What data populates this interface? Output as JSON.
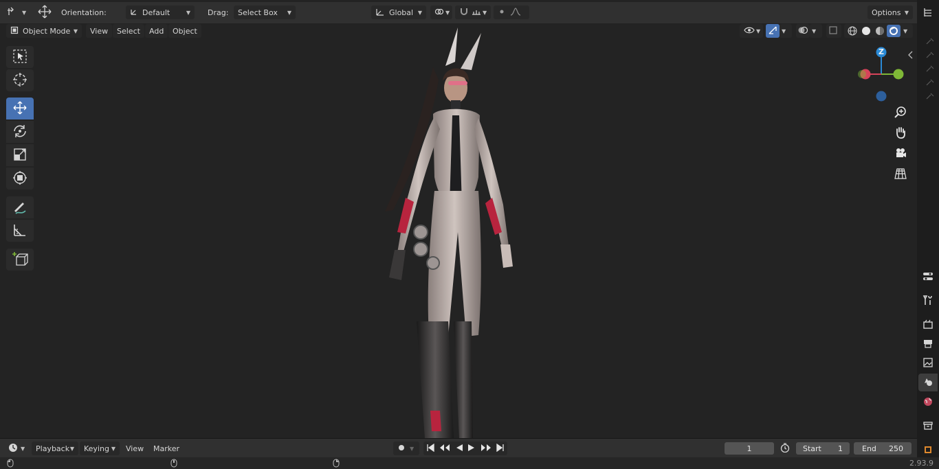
{
  "header": {
    "orientation_label": "Orientation:",
    "orientation_value": "Default",
    "drag_label": "Drag:",
    "drag_value": "Select Box",
    "transform_space": "Global",
    "options_label": "Options"
  },
  "viewport_header": {
    "mode": "Object Mode",
    "menus": [
      "View",
      "Select",
      "Add",
      "Object"
    ]
  },
  "gizmo": {
    "z_label": "Z"
  },
  "timeline": {
    "menus": [
      "Playback",
      "Keying",
      "View",
      "Marker"
    ],
    "current_frame": "1",
    "start_label": "Start",
    "start_value": "1",
    "end_label": "End",
    "end_value": "250"
  },
  "status": {
    "version": "2.93.9"
  },
  "colors": {
    "accent": "#4772b3",
    "axis_x": "#d7435a",
    "axis_y": "#7fb837",
    "axis_z": "#2a8ad6",
    "header_bg": "#303030",
    "viewport_bg": "#232323"
  },
  "icons": {
    "toolbar": [
      "select-box-icon",
      "cursor-icon",
      "move-icon",
      "rotate-icon",
      "scale-icon",
      "transform-icon",
      "annotate-icon",
      "measure-icon",
      "add-cube-icon"
    ],
    "nav": [
      "zoom-icon",
      "hand-pan-icon",
      "camera-icon",
      "grid-ortho-icon"
    ],
    "properties_tabs": [
      "tool-icon",
      "render-icon",
      "output-icon",
      "view-layer-icon",
      "scene-icon",
      "world-icon",
      "collection-icon",
      "object-icon"
    ]
  }
}
